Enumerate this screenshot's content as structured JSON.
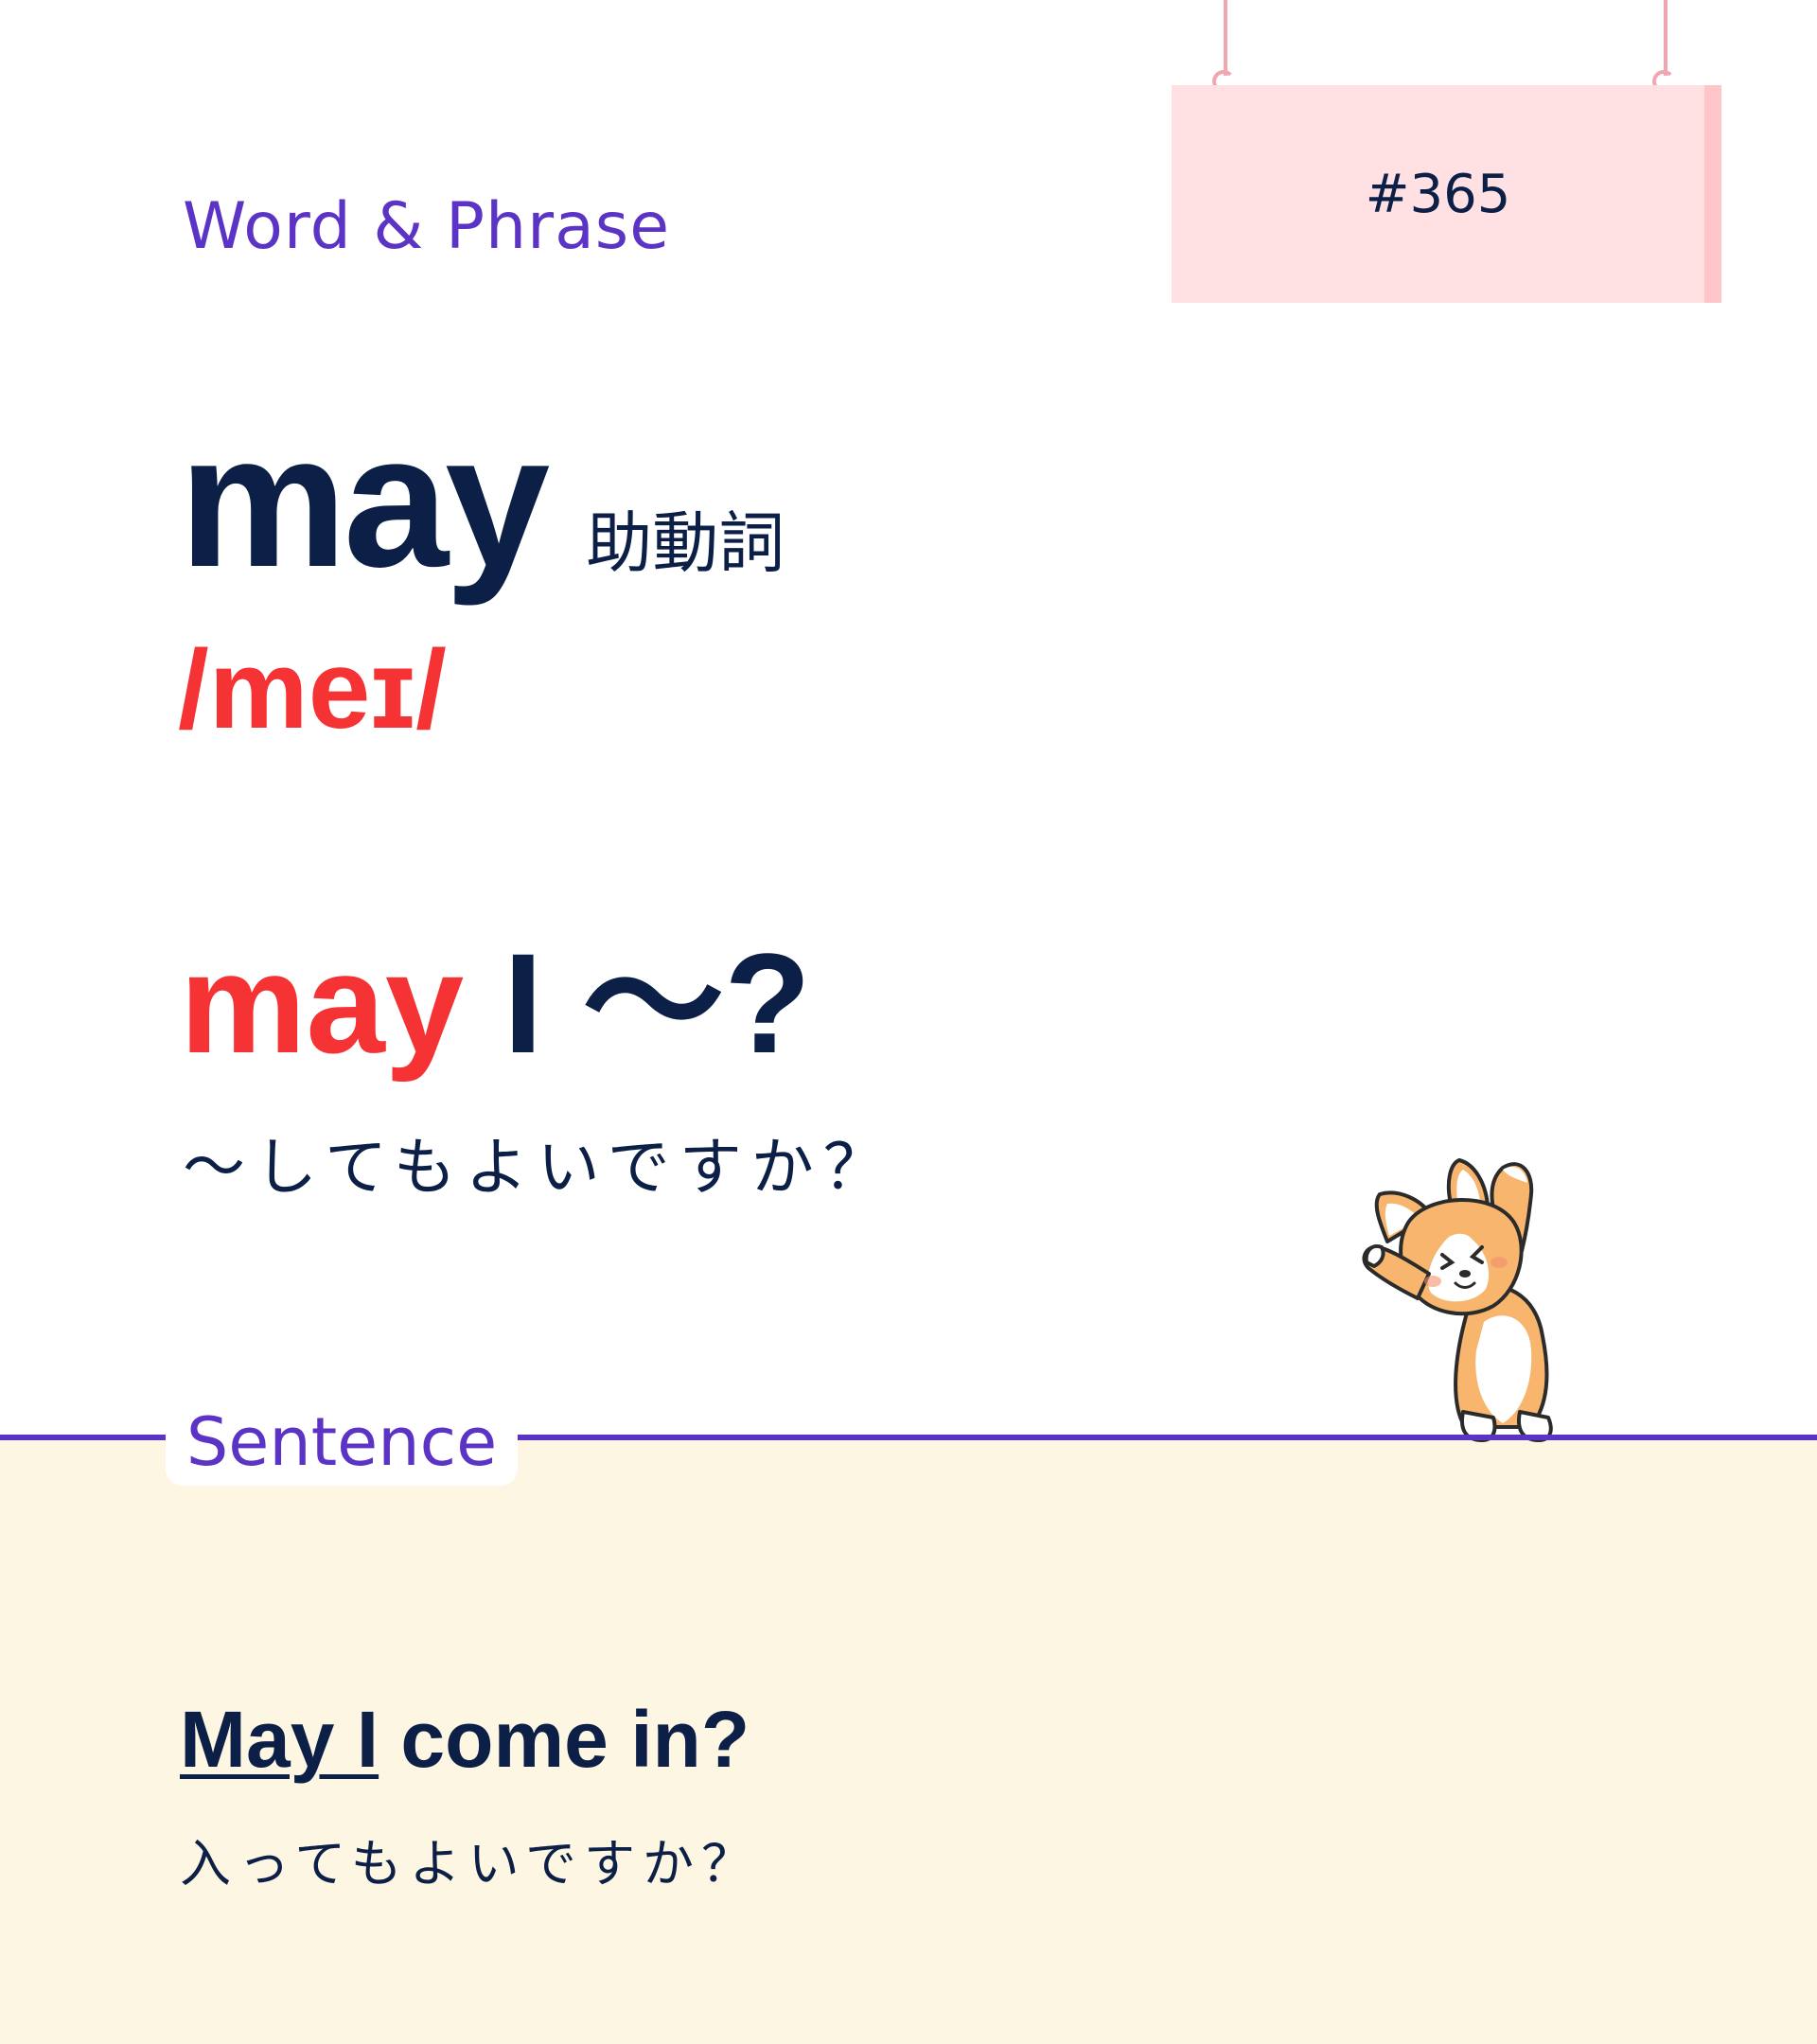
{
  "category": "Word & Phrase",
  "card_number": "#365",
  "entry": {
    "word": "may",
    "part_of_speech": "助動詞",
    "pronunciation": "/meɪ/"
  },
  "phrase": {
    "highlight": "may",
    "rest": " I ～?",
    "meaning": "～してもよいですか？"
  },
  "section": {
    "label": "Sentence"
  },
  "example": {
    "underlined": "May I",
    "rest": " come in?",
    "translation": "入ってもよいですか？"
  },
  "colors": {
    "accent_purple": "#5b33c5",
    "accent_red": "#f53334",
    "text_navy": "#0c1f46",
    "sign_pink": "#ffe0e3",
    "sentence_bg": "#fdf6e3"
  },
  "illustration": "corgi-stretching"
}
